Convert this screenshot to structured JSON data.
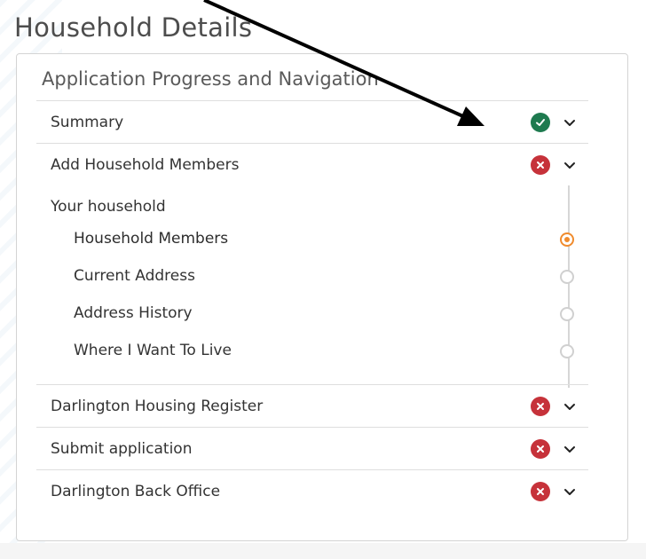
{
  "page": {
    "title": "Household Details"
  },
  "panel": {
    "title": "Application Progress and Navigation",
    "sections": [
      {
        "label": "Summary",
        "status": "complete"
      },
      {
        "label": "Add Household Members",
        "status": "incomplete"
      },
      {
        "label": "Darlington Housing Register",
        "status": "incomplete"
      },
      {
        "label": "Submit application",
        "status": "incomplete"
      },
      {
        "label": "Darlington Back Office",
        "status": "incomplete"
      }
    ],
    "sub_group": {
      "label": "Your household",
      "steps": [
        {
          "label": "Household Members",
          "state": "current"
        },
        {
          "label": "Current Address",
          "state": "pending"
        },
        {
          "label": "Address History",
          "state": "pending"
        },
        {
          "label": "Where I Want To Live",
          "state": "pending"
        }
      ]
    }
  },
  "colors": {
    "complete": "#1e7a4f",
    "incomplete": "#c6323a",
    "current_step": "#f08b2d",
    "annotation_arrow": "#000000"
  },
  "icons": {
    "complete": "check-circle-icon",
    "incomplete": "x-circle-icon",
    "expand": "chevron-down-icon"
  }
}
